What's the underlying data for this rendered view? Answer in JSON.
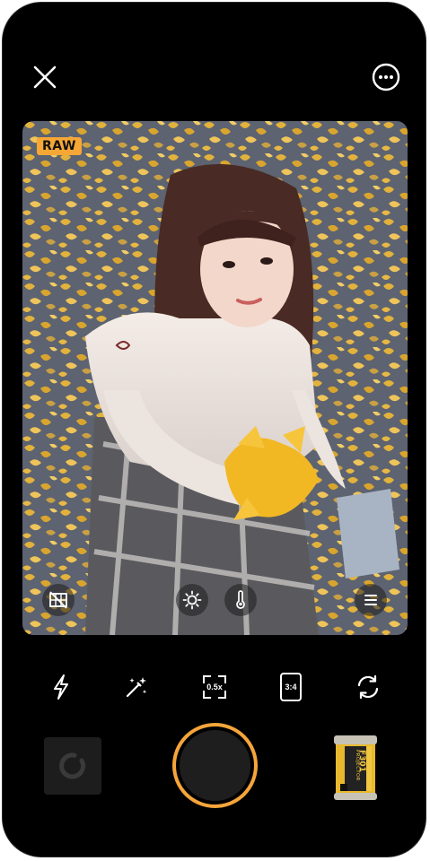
{
  "viewfinder": {
    "format_badge": "RAW"
  },
  "toolbar": {
    "zoom_label": "0.5x",
    "aspect_ratio_label": "3:4"
  },
  "film_roll": {
    "brand": "PROJECTOR",
    "model": "F301"
  },
  "colors": {
    "accent": "#f5a53a",
    "background": "#000000"
  },
  "icons": {
    "close": "close-icon",
    "more": "more-options-icon",
    "grid": "grid-overlay-icon",
    "exposure": "sun-icon",
    "temperature": "thermometer-icon",
    "menu": "menu-icon",
    "flash": "flash-icon",
    "magic": "magic-wand-icon",
    "flip": "flip-camera-icon",
    "gallery": "loading-icon"
  }
}
